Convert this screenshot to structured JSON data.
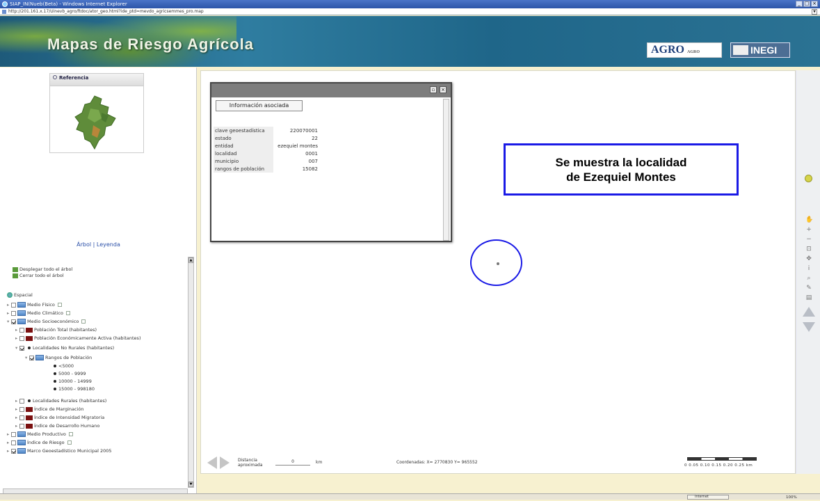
{
  "window": {
    "title": "SIAP_IN(Nueb(Beta) - Windows Internet Explorer",
    "controls": [
      "_",
      "□",
      "×"
    ]
  },
  "address": {
    "url": "http://201.161.x.17/Uinevb_agro/ftdoc/ator_geo.html?ide_ptd=mevdo_agricsemmes_pro.map"
  },
  "banner": {
    "title": "Mapas de Riesgo Agrícola",
    "logo_agro": "AGRO",
    "logo_agro_sub": "AGRO",
    "logo_inegi": "INEGI"
  },
  "left": {
    "reference_title": "Referencia",
    "tabs_links": "Árbol | Leyenda",
    "actions": [
      "Desplegar todo el árbol",
      "Cerrar todo el árbol"
    ],
    "tree": {
      "root": "Espacial",
      "items": [
        "Medio Físico",
        "Medio Climático",
        "Medio Socioeconómico",
        "Población Total (habitantes)",
        "Población Económicamente Activa (habitantes)",
        "Localidades No Rurales (habitantes)",
        "Rangos de Población",
        "<5000",
        "5000 - 9999",
        "10000 - 14999",
        "15000 - 998180",
        "Localidades Rurales (habitantes)",
        "Índice de Marginación",
        "Índice de Intensidad Migratoria",
        "Índice de Desarrollo Humano",
        "Medio Productivo",
        "Índice de Riesgo",
        "Marco Geoestadístico Municipal 2005"
      ]
    }
  },
  "popup": {
    "tab_label": "Información asociada",
    "rows": [
      {
        "k": "clave geoestadística",
        "v": "220070001"
      },
      {
        "k": "estado",
        "v": "22"
      },
      {
        "k": "entidad",
        "v": "ezequiel montes"
      },
      {
        "k": "localidad",
        "v": "0001"
      },
      {
        "k": "municipio",
        "v": "007"
      },
      {
        "k": "rangos de población",
        "v": "15082"
      }
    ]
  },
  "annotation": {
    "line1": "Se muestra la localidad",
    "line2": "de Ezequiel Montes"
  },
  "bottom": {
    "distance_label": "Distancia aproximada",
    "distance_value": "0",
    "distance_unit": "km",
    "coords": "Coordenadas: X= 2770830 Y= 965552",
    "scale_labels": "0   0.05  0.10  0.15  0.20  0.25 km"
  },
  "status": {
    "zone": "Internet",
    "zoom": "100%"
  }
}
